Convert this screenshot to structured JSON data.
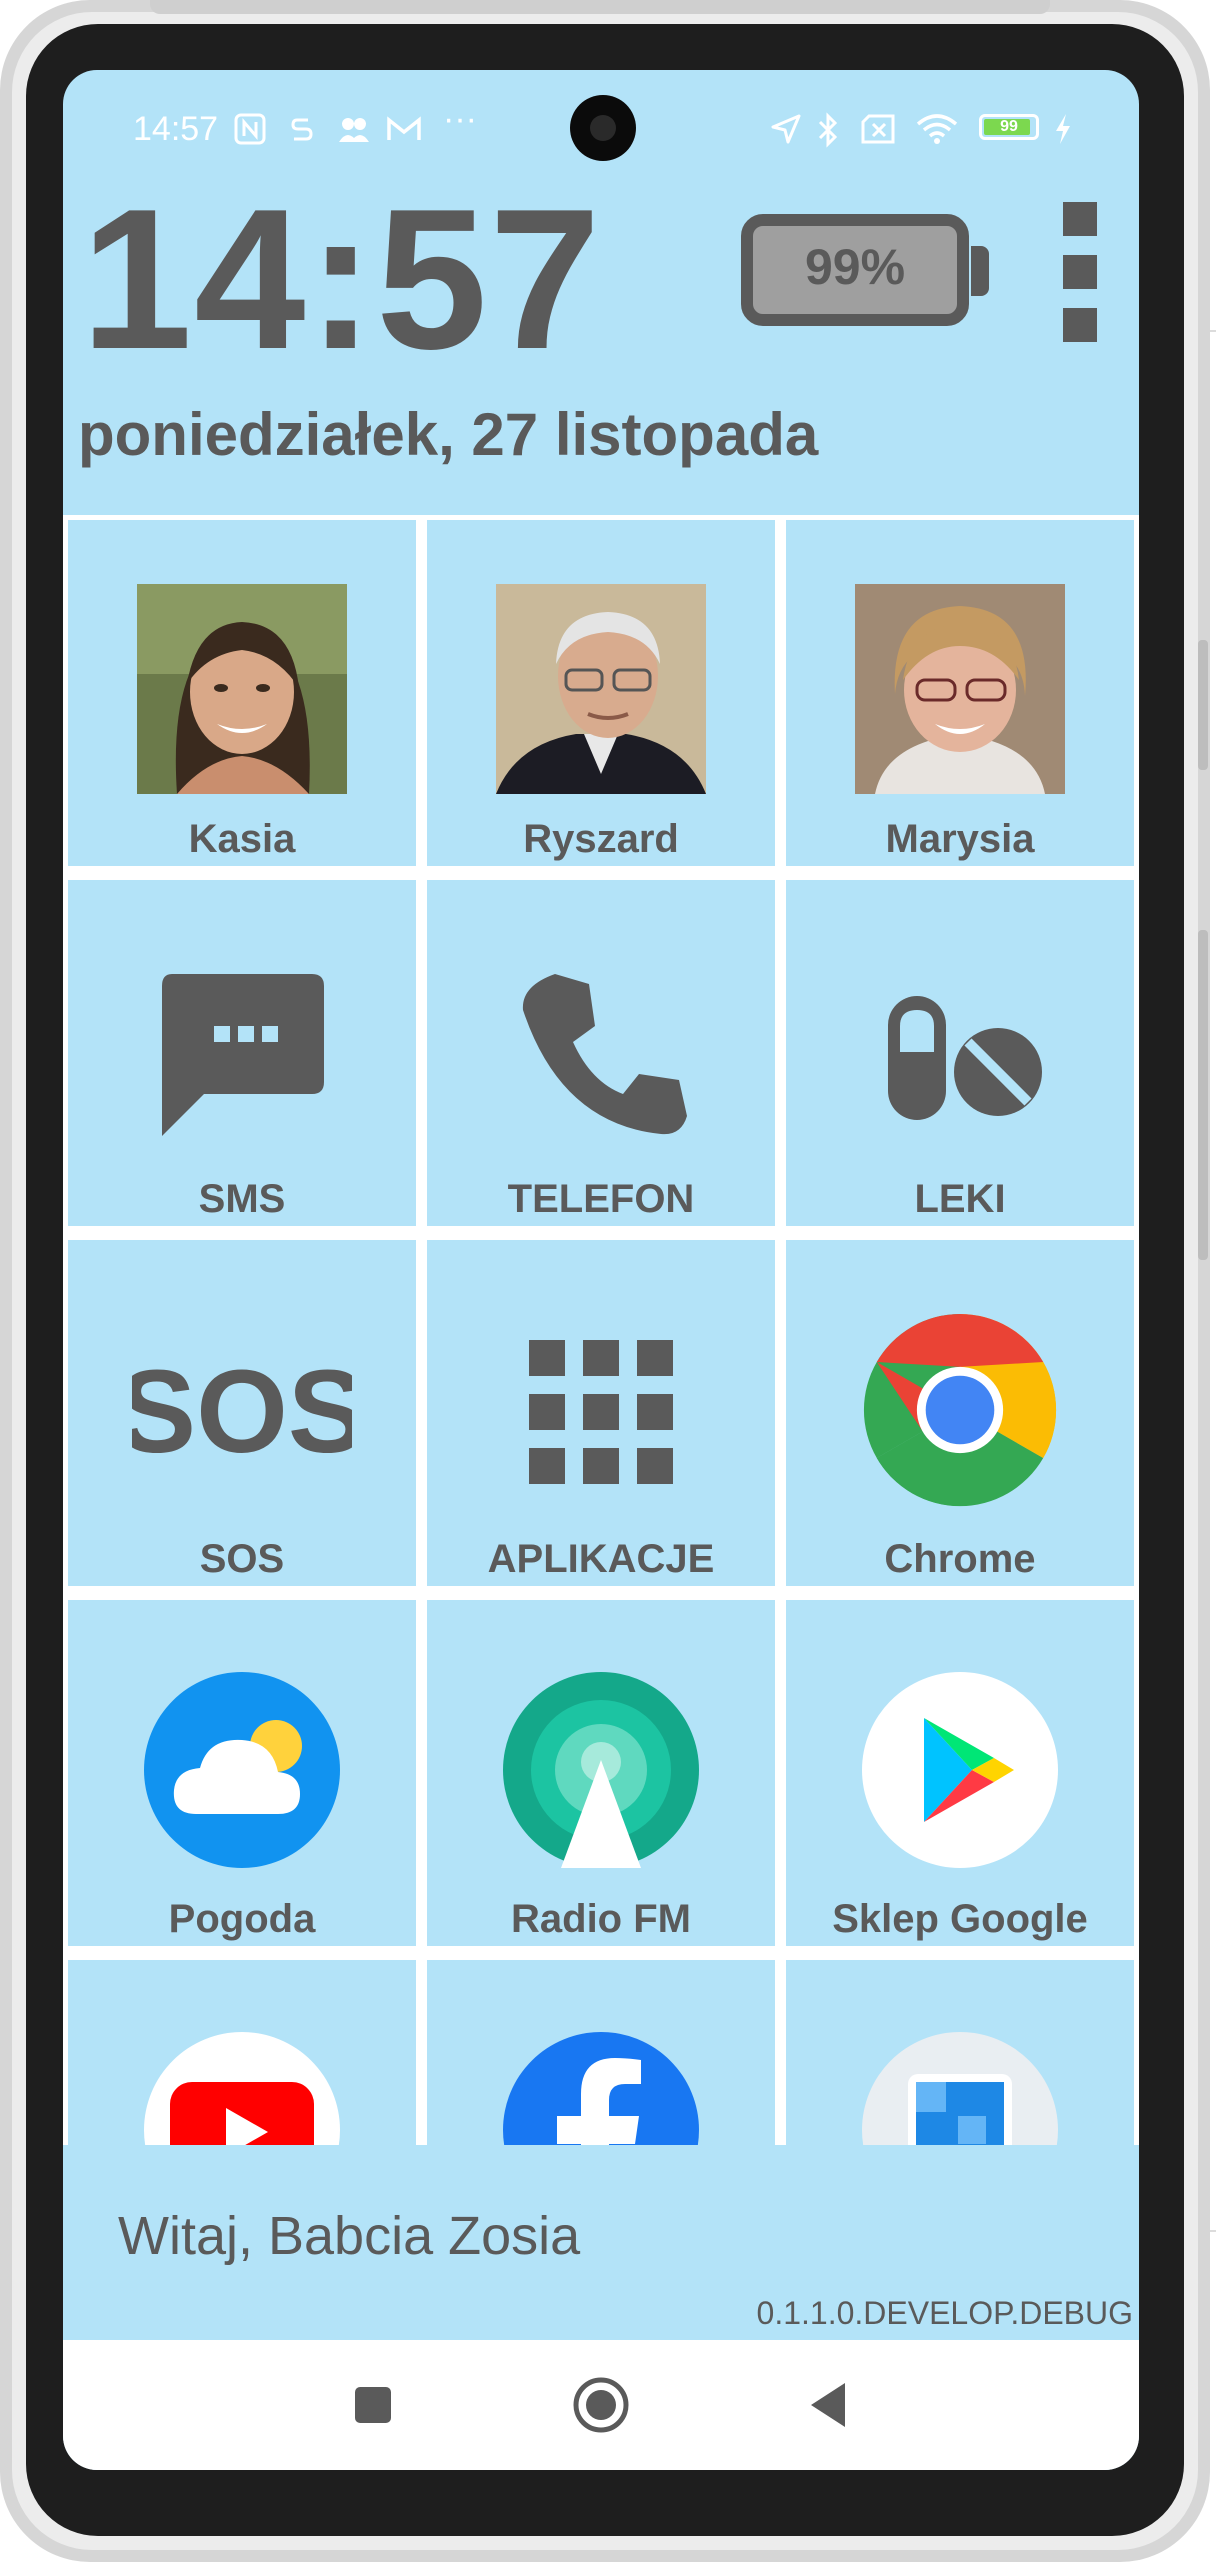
{
  "status_bar": {
    "time": "14:57",
    "left_icons": [
      "nfc-icon",
      "s-app-icon",
      "people-icon",
      "gmail-icon",
      "more-icon"
    ],
    "right_icons": [
      "location-icon",
      "bluetooth-icon",
      "no-sim-icon",
      "wifi-icon",
      "battery-icon",
      "charging-icon"
    ],
    "battery_level": "99"
  },
  "header": {
    "clock": "14:57",
    "date": "poniedziałek, 27 listopada",
    "battery_percent": "99%"
  },
  "tiles": [
    {
      "label": "Kasia",
      "icon": "contact-photo-kasia"
    },
    {
      "label": "Ryszard",
      "icon": "contact-photo-ryszard"
    },
    {
      "label": "Marysia",
      "icon": "contact-photo-marysia"
    },
    {
      "label": "SMS",
      "icon": "sms-icon"
    },
    {
      "label": "TELEFON",
      "icon": "phone-icon"
    },
    {
      "label": "LEKI",
      "icon": "pills-icon"
    },
    {
      "label": "SOS",
      "icon": "sos-icon",
      "icon_text": "SOS"
    },
    {
      "label": "APLIKACJE",
      "icon": "apps-grid-icon"
    },
    {
      "label": "Chrome",
      "icon": "chrome-icon"
    },
    {
      "label": "Pogoda",
      "icon": "weather-icon"
    },
    {
      "label": "Radio FM",
      "icon": "radio-icon"
    },
    {
      "label": "Sklep Google",
      "icon": "play-store-icon"
    },
    {
      "label": "",
      "icon": "youtube-icon"
    },
    {
      "label": "",
      "icon": "facebook-icon"
    },
    {
      "label": "",
      "icon": "gallery-icon"
    }
  ],
  "footer": {
    "greeting": "Witaj, Babcia Zosia",
    "version": "0.1.1.0.DEVELOP.DEBUG"
  },
  "nav_bar": {
    "buttons": [
      "recents-button",
      "home-button",
      "back-button"
    ]
  },
  "colors": {
    "screen_bg": "#b3e3f8",
    "text_gray": "#5a5a5a",
    "grid_gap": "#ffffff"
  }
}
